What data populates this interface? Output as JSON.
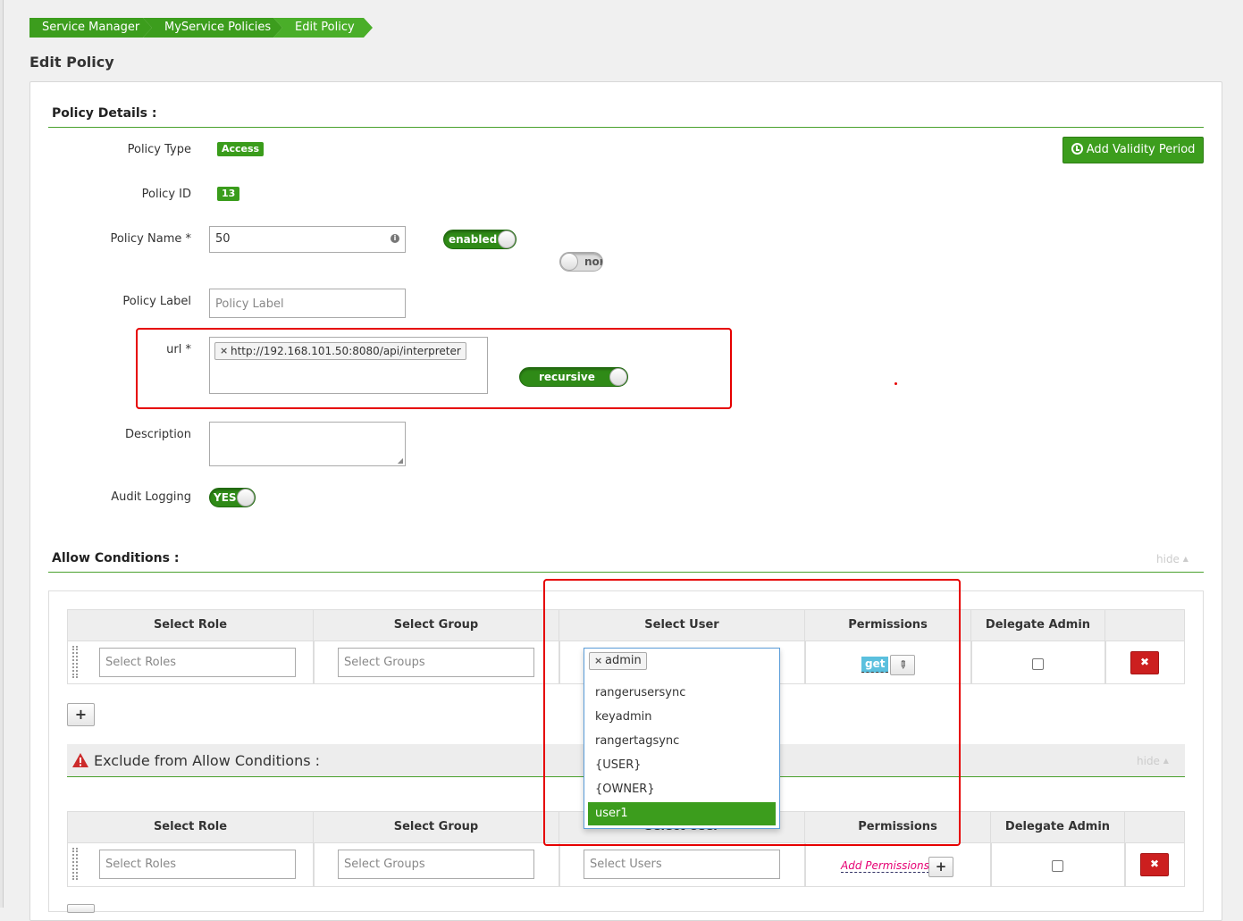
{
  "breadcrumb": [
    "Service Manager",
    "MyService Policies",
    "Edit Policy"
  ],
  "page_title": "Edit Policy",
  "policy_details": {
    "section_title": "Policy Details :",
    "add_validity_label": "Add Validity Period",
    "policy_type_label": "Policy Type",
    "policy_type_value": "Access",
    "policy_id_label": "Policy ID",
    "policy_id_value": "13",
    "policy_name_label": "Policy Name *",
    "policy_name_value": "50",
    "enabled_toggle": "enabled",
    "normal_toggle": "nor",
    "policy_label_label": "Policy Label",
    "policy_label_placeholder": "Policy Label",
    "url_label": "url *",
    "url_tag": "http://192.168.101.50:8080/api/interpreter",
    "recursive_toggle": "recursive",
    "description_label": "Description",
    "audit_logging_label": "Audit Logging",
    "audit_logging_value": "YES"
  },
  "allow_conditions": {
    "section_title": "Allow Conditions :",
    "hide_label": "hide",
    "headers": [
      "Select Role",
      "Select Group",
      "Select User",
      "Permissions",
      "Delegate Admin"
    ],
    "row": {
      "roles_placeholder": "Select Roles",
      "groups_placeholder": "Select Groups",
      "user_tag": "admin",
      "permission": "get"
    },
    "user_dropdown_options": [
      "rangerusersync",
      "keyadmin",
      "rangertagsync",
      "{USER}",
      "{OWNER}",
      "user1"
    ],
    "user_dropdown_selected": "user1"
  },
  "exclude_conditions": {
    "section_title": "Exclude from Allow Conditions :",
    "hide_label": "hide",
    "headers": [
      "Select Role",
      "Select Group",
      "Select User",
      "Permissions",
      "Delegate Admin"
    ],
    "row": {
      "roles_placeholder": "Select Roles",
      "groups_placeholder": "Select Groups",
      "users_placeholder": "Select Users",
      "add_permissions": "Add Permissions"
    }
  },
  "colors": {
    "accent": "#3c9d1d",
    "annotation": "#e60000",
    "delete": "#cc1f1f"
  }
}
